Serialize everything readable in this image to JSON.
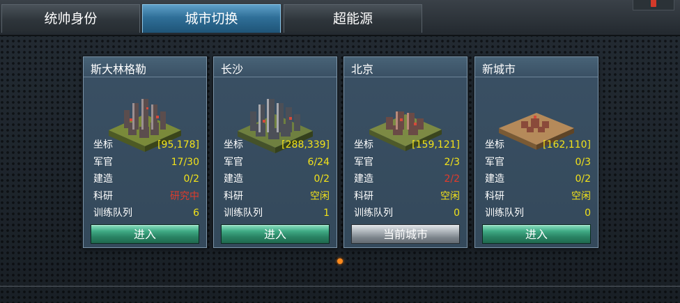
{
  "tabs": [
    {
      "label": "统帅身份",
      "active": false
    },
    {
      "label": "城市切换",
      "active": true
    },
    {
      "label": "超能源",
      "active": false
    }
  ],
  "row_labels": {
    "coords": "坐标",
    "officer": "军官",
    "build": "建造",
    "research": "科研",
    "train": "训练队列"
  },
  "cities": [
    {
      "name": "斯大林格勒",
      "coords": "[95,178]",
      "officer": "17/30",
      "build": "0/2",
      "research": "研究中",
      "research_status": "busy",
      "train": "6",
      "button": "进入",
      "is_current": false
    },
    {
      "name": "长沙",
      "coords": "[288,339]",
      "officer": "6/24",
      "build": "0/2",
      "research": "空闲",
      "research_status": "idle",
      "train": "1",
      "button": "进入",
      "is_current": false
    },
    {
      "name": "北京",
      "coords": "[159,121]",
      "officer": "2/3",
      "build": "2/2",
      "build_status": "full",
      "research": "空闲",
      "research_status": "idle",
      "train": "0",
      "button": "当前城市",
      "is_current": true
    },
    {
      "name": "新城市",
      "coords": "[162,110]",
      "officer": "0/3",
      "build": "0/2",
      "research": "空闲",
      "research_status": "idle",
      "train": "0",
      "button": "进入",
      "is_current": false
    }
  ],
  "pagination": {
    "pages": 1,
    "current": 1
  },
  "colors": {
    "value": "#f2e21a",
    "busy": "#e23b2b",
    "active_tab": "#2f6f98",
    "enter_button": "#3faa84",
    "pager_dot": "#ff8a1c"
  }
}
